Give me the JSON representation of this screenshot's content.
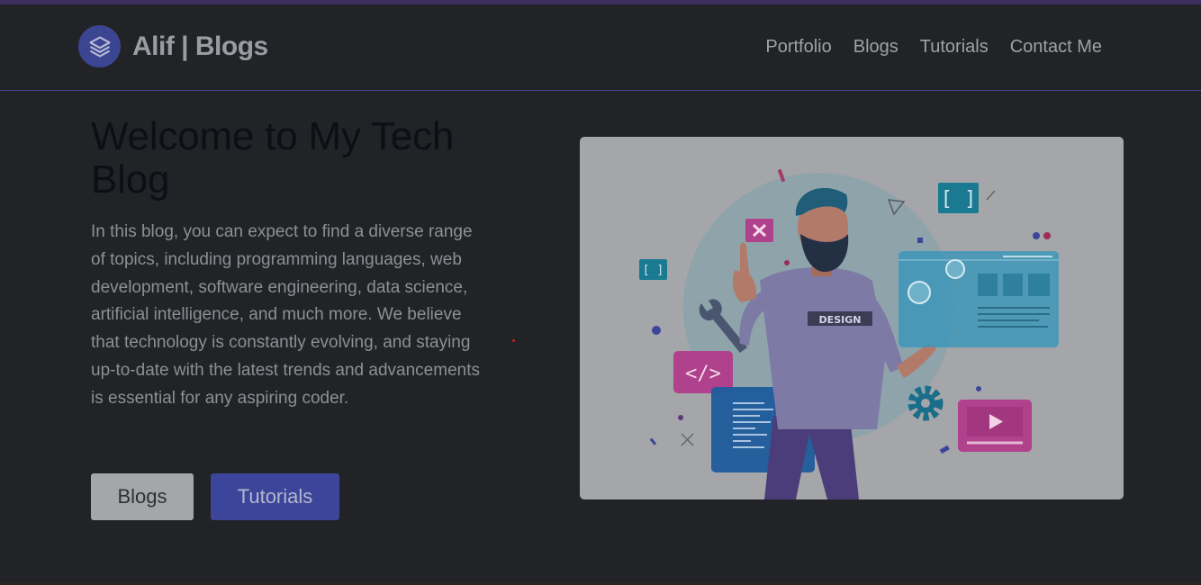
{
  "brand": {
    "logo_icon": "layers-icon",
    "name": "Alif | Blogs"
  },
  "nav": {
    "items": [
      {
        "label": "Portfolio"
      },
      {
        "label": "Blogs"
      },
      {
        "label": "Tutorials"
      },
      {
        "label": "Contact Me"
      }
    ]
  },
  "hero": {
    "title": "Welcome to My Tech Blog",
    "description": "In this blog, you can expect to find a diverse range of topics, including programming languages, web development, software engineering, data science, artificial intelligence, and much more. We believe that technology is constantly evolving, and staying up-to-date with the latest trends and advancements is essential for any aspiring coder.",
    "buttons": {
      "blogs": "Blogs",
      "tutorials": "Tutorials"
    },
    "illustration": {
      "badge_text": "DESIGN"
    }
  },
  "colors": {
    "background": "#212327",
    "accent": "#3c4599",
    "nav_border": "#3f458f"
  }
}
